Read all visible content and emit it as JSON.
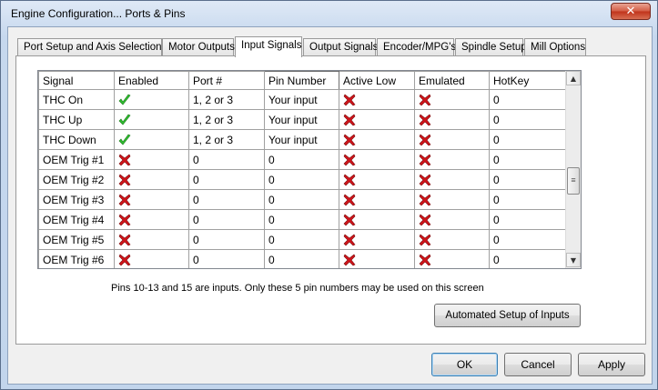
{
  "window": {
    "title": "Engine Configuration... Ports & Pins",
    "close_glyph": "✕"
  },
  "tabs": [
    {
      "label": "Port Setup and Axis Selection"
    },
    {
      "label": "Motor Outputs"
    },
    {
      "label": "Input Signals",
      "active": true
    },
    {
      "label": "Output Signals"
    },
    {
      "label": "Encoder/MPG's"
    },
    {
      "label": "Spindle Setup"
    },
    {
      "label": "Mill Options"
    }
  ],
  "grid": {
    "columns": [
      "Signal",
      "Enabled",
      "Port #",
      "Pin Number",
      "Active Low",
      "Emulated",
      "HotKey"
    ],
    "rows": [
      {
        "signal": "THC On",
        "enabled": true,
        "port": "1, 2 or 3",
        "pin": "Your input",
        "active_low": false,
        "emulated": false,
        "hotkey": "0"
      },
      {
        "signal": "THC Up",
        "enabled": true,
        "port": "1, 2 or 3",
        "pin": "Your input",
        "active_low": false,
        "emulated": false,
        "hotkey": "0"
      },
      {
        "signal": "THC Down",
        "enabled": true,
        "port": "1, 2 or 3",
        "pin": "Your input",
        "active_low": false,
        "emulated": false,
        "hotkey": "0"
      },
      {
        "signal": "OEM Trig #1",
        "enabled": false,
        "port": "0",
        "pin": "0",
        "active_low": false,
        "emulated": false,
        "hotkey": "0"
      },
      {
        "signal": "OEM Trig #2",
        "enabled": false,
        "port": "0",
        "pin": "0",
        "active_low": false,
        "emulated": false,
        "hotkey": "0"
      },
      {
        "signal": "OEM Trig #3",
        "enabled": false,
        "port": "0",
        "pin": "0",
        "active_low": false,
        "emulated": false,
        "hotkey": "0"
      },
      {
        "signal": "OEM Trig #4",
        "enabled": false,
        "port": "0",
        "pin": "0",
        "active_low": false,
        "emulated": false,
        "hotkey": "0"
      },
      {
        "signal": "OEM Trig #5",
        "enabled": false,
        "port": "0",
        "pin": "0",
        "active_low": false,
        "emulated": false,
        "hotkey": "0"
      },
      {
        "signal": "OEM Trig #6",
        "enabled": false,
        "port": "0",
        "pin": "0",
        "active_low": false,
        "emulated": false,
        "hotkey": "0"
      }
    ],
    "scrollbar": {
      "up_glyph": "▲",
      "down_glyph": "▼",
      "thumb_glyph": "≡"
    },
    "check_icon": "green-check-icon",
    "cross_icon": "red-x-icon",
    "check_color": "#2fbf2f",
    "cross_color": "#d0141b"
  },
  "note": "Pins 10-13 and 15 are inputs. Only these 5 pin numbers may be used on this screen",
  "buttons": {
    "automated_setup": "Automated Setup of Inputs",
    "ok": "OK",
    "cancel": "Cancel",
    "apply": "Apply"
  }
}
